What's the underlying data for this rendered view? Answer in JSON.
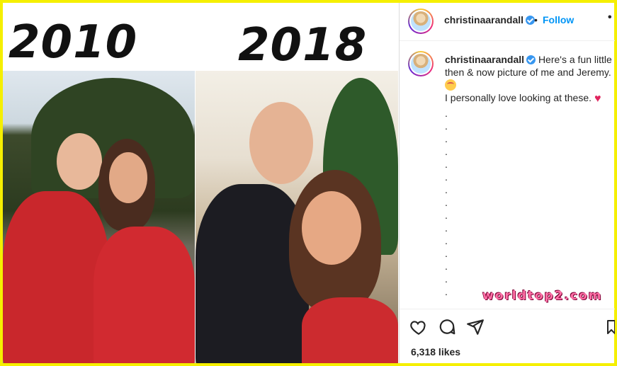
{
  "image": {
    "year_left": "2010",
    "year_right": "2018"
  },
  "post": {
    "username": "christinaarandall",
    "follow_label": "Follow",
    "separator": "•",
    "more_label": "•",
    "caption_text": "Here's a fun little then & now picture of me and Jeremy.",
    "caption_line2": "I personally love looking at these.",
    "caption_dots": [
      ".",
      ".",
      ".",
      ".",
      ".",
      ".",
      ".",
      ".",
      ".",
      ".",
      ".",
      ".",
      ".",
      ".",
      "."
    ],
    "likes": "6,318 likes"
  },
  "watermark": "worldtop2.com",
  "icons": [
    "verified-badge-icon",
    "heart-icon",
    "comment-icon",
    "share-icon",
    "bookmark-icon",
    "smiling-face-icon",
    "red-heart-icon"
  ],
  "colors": {
    "frame": "#f5ef00",
    "follow": "#0095f6",
    "verified": "#3897f0",
    "text": "#262626"
  }
}
